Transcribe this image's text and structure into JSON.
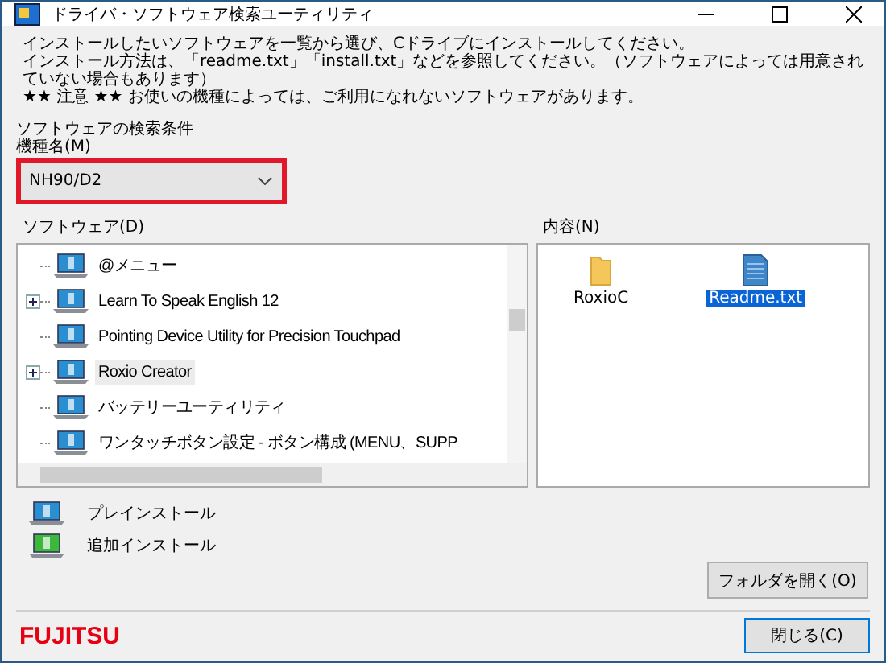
{
  "window": {
    "title": "ドライバ・ソフトウェア検索ユーティリティ"
  },
  "instructions": [
    "インストールしたいソフトウェアを一覧から選び、Cドライブにインストールしてください。",
    "インストール方法は、「readme.txt」「install.txt」などを参照してください。（ソフトウェアによっては用意されていない場合もあります）",
    "★★ 注意 ★★ お使いの機種によっては、ご利用になれないソフトウェアがあります。"
  ],
  "search": {
    "heading": "ソフトウェアの検索条件",
    "model_label": "機種名(M)",
    "model_value": "NH90/D2",
    "highlighted": true
  },
  "software": {
    "label": "ソフトウェア(D)",
    "items": [
      {
        "label": "@メニュー",
        "kind": "preinstall",
        "expandable": false,
        "selected": false
      },
      {
        "label": "Learn To Speak English 12",
        "kind": "preinstall",
        "expandable": true,
        "selected": false
      },
      {
        "label": "Pointing Device Utility for Precision Touchpad",
        "kind": "preinstall",
        "expandable": false,
        "selected": false
      },
      {
        "label": "Roxio Creator",
        "kind": "preinstall",
        "expandable": true,
        "selected": true
      },
      {
        "label": "バッテリーユーティリティ",
        "kind": "preinstall",
        "expandable": false,
        "selected": false
      },
      {
        "label": "ワンタッチボタン設定 - ボタン構成 (MENU、SUPP",
        "kind": "preinstall",
        "expandable": false,
        "selected": false
      }
    ]
  },
  "contents": {
    "label": "内容(N)",
    "files": [
      {
        "name": "RoxioC",
        "kind": "folder",
        "selected": false
      },
      {
        "name": "Readme.txt",
        "kind": "text",
        "selected": true
      }
    ]
  },
  "legend": [
    {
      "label": "プレインストール",
      "kind": "preinstall"
    },
    {
      "label": "追加インストール",
      "kind": "addon"
    }
  ],
  "buttons": {
    "open_folder": "フォルダを開く(O)",
    "close": "閉じる(C)"
  },
  "logo": "FUJITSU"
}
